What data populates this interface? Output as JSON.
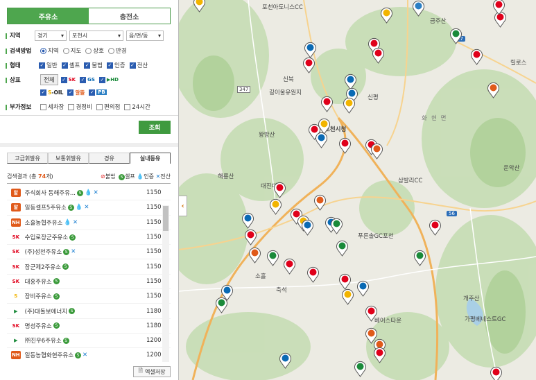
{
  "tabs": {
    "gas": "주유소",
    "charge": "충전소"
  },
  "region": {
    "label": "지역",
    "province": "경기",
    "city": "포천시",
    "town": "읍/면/동"
  },
  "method": {
    "label": "검색방법",
    "options": [
      "지역",
      "지도",
      "상호",
      "반경"
    ],
    "selected": 0
  },
  "type": {
    "label": "형태",
    "options": [
      "일반",
      "셀프",
      "불법",
      "인증",
      "전산"
    ]
  },
  "brand": {
    "label": "상표",
    "all": "전체",
    "items": [
      "SK에너지",
      "GS칼텍스",
      "HD현대오일뱅크",
      "S-OIL",
      "알뜰",
      "PB"
    ]
  },
  "extra": {
    "label": "부가정보",
    "options": [
      "세차장",
      "경정비",
      "편의점",
      "24시간"
    ]
  },
  "search_button": "조회",
  "fuel_tabs": [
    "고급휘발유",
    "보통휘발유",
    "경유",
    "실내등유"
  ],
  "result": {
    "prefix": "검색결과 (총 ",
    "count": "74",
    "suffix": "개)",
    "legend": [
      "불법",
      "셀프",
      "인증",
      "전산"
    ]
  },
  "stations": [
    {
      "name": "주식회사 동해주유...",
      "brand": "알뜰",
      "price": "1150",
      "badges": [
        "셀프",
        "인증",
        "전산"
      ]
    },
    {
      "name": "일동셀프5주유소",
      "brand": "알뜰",
      "price": "1150",
      "badges": [
        "셀프",
        "인증",
        "전산"
      ]
    },
    {
      "name": "소흘농협주유소",
      "brand": "NH알뜰",
      "price": "1150",
      "badges": [
        "인증",
        "전산"
      ]
    },
    {
      "name": "수입로장군주유소",
      "brand": "SK",
      "price": "1150",
      "badges": [
        "셀프"
      ]
    },
    {
      "name": "(주)성천주유소",
      "brand": "SK",
      "price": "1150",
      "badges": [
        "셀프",
        "전산"
      ]
    },
    {
      "name": "장군제2주유소",
      "brand": "SK",
      "price": "1150",
      "badges": [
        "셀프"
      ]
    },
    {
      "name": "대홍주유소",
      "brand": "SK",
      "price": "1150",
      "badges": [
        "셀프"
      ]
    },
    {
      "name": "장비주유소",
      "brand": "S-OIL",
      "price": "1150",
      "badges": [
        "셀프"
      ]
    },
    {
      "name": "(주)대돌보에너지",
      "brand": "HD",
      "price": "1180",
      "badges": [
        "셀프"
      ]
    },
    {
      "name": "명성주유소",
      "brand": "SK",
      "price": "1180",
      "badges": [
        "셀프"
      ]
    },
    {
      "name": "㈜진우6주유소",
      "brand": "HD",
      "price": "1200",
      "badges": [
        "셀프"
      ]
    },
    {
      "name": "일동농협화현주유소",
      "brand": "NH알뜰",
      "price": "1200",
      "badges": [
        "셀프",
        "전산"
      ]
    }
  ],
  "excel_button": "엑셀저장",
  "map_labels": [
    "포천아도니스CC",
    "금주산",
    "릴로스",
    "길이울유원지",
    "신북",
    "신평",
    "화현면",
    "왕방산",
    "포천시청",
    "운악산",
    "해룡산",
    "대진대",
    "삼발리CC",
    "푸른솔GC포천",
    "소흘",
    "축석",
    "개주산",
    "가평베네스트GC",
    "베어스타운",
    "347",
    "47",
    "56"
  ]
}
